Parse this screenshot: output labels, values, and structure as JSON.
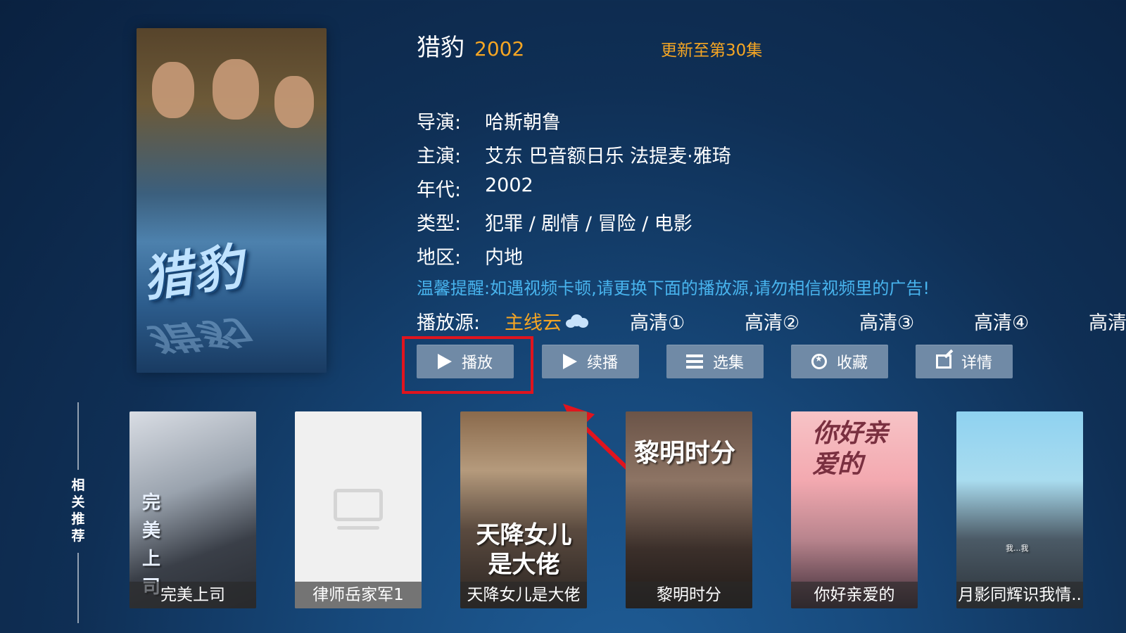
{
  "title": {
    "name": "猎豹",
    "year": "2002",
    "update": "更新至第30集"
  },
  "poster": {
    "art_text": "猎豹"
  },
  "info": [
    {
      "label": "导演:",
      "value": "哈斯朝鲁"
    },
    {
      "label": "主演:",
      "value": "艾东 巴音额日乐 法提麦·雅琦"
    },
    {
      "label": "年代:",
      "value": "2002"
    },
    {
      "label": "类型:",
      "value": "犯罪 / 剧情 / 冒险 / 电影"
    },
    {
      "label": "地区:",
      "value": "内地"
    }
  ],
  "tip": "温馨提醒:如遇视频卡顿,请更换下面的播放源,请勿相信视频里的广告!",
  "sources": {
    "label": "播放源:",
    "items": [
      "主线云",
      "高清①",
      "高清②",
      "高清③",
      "高清④",
      "高清"
    ],
    "active_index": 0
  },
  "buttons": {
    "play": "播放",
    "resume": "续播",
    "episodes": "选集",
    "favorite": "收藏",
    "details": "详情"
  },
  "related": {
    "label": "相关推荐",
    "items": [
      {
        "caption": "完美上司",
        "art_text": "完美上司"
      },
      {
        "caption": "律师岳家军1"
      },
      {
        "caption": "天降女儿是大佬",
        "art_text": "天降女儿是大佬"
      },
      {
        "caption": "黎明时分",
        "art_text": "黎明时分"
      },
      {
        "caption": "你好亲爱的",
        "art_text": "你好亲爱的"
      },
      {
        "caption": "月影同辉识我情..",
        "art_text": "我...我"
      }
    ]
  },
  "colors": {
    "accent": "#f6a623",
    "tip": "#48b4ee",
    "button": "#708aa6",
    "highlight": "#e0141e"
  },
  "icons": {
    "play": "play-icon",
    "resume": "play-icon",
    "episodes": "list-icon",
    "favorite": "favorite-icon",
    "details": "edit-icon",
    "source_active": "cloud-icon",
    "placeholder": "tv-placeholder-icon"
  }
}
